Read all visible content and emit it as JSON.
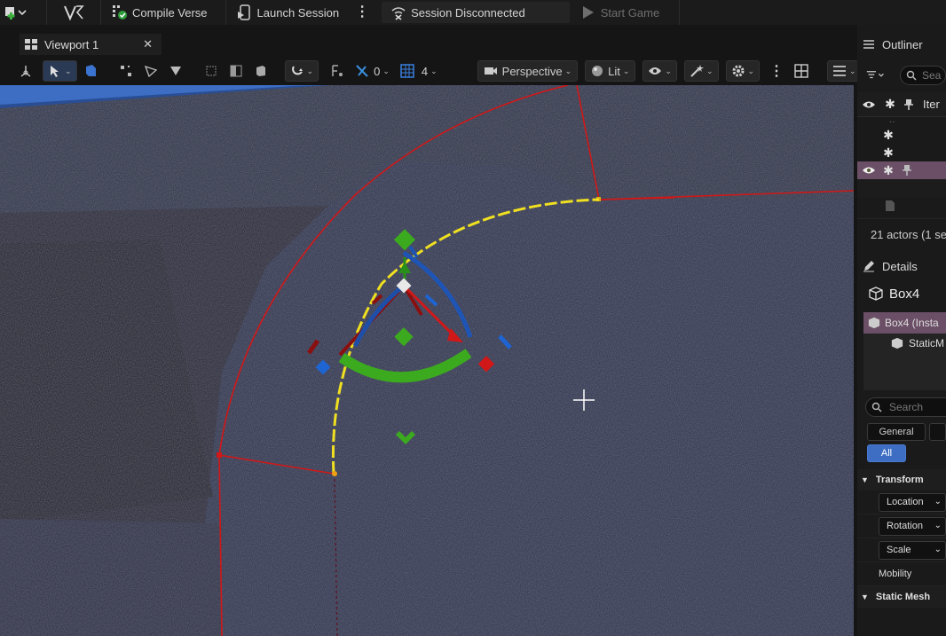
{
  "toolbar": {
    "compile_verse": "Compile Verse",
    "launch_session": "Launch Session",
    "session_status": "Session Disconnected",
    "start_game": "Start Game"
  },
  "viewport_tab": {
    "label": "Viewport 1",
    "close": "✕"
  },
  "viewport_toolbar": {
    "rotation_snap_value": "0",
    "grid_value": "4",
    "view_mode": "Perspective",
    "lighting_mode": "Lit"
  },
  "outliner": {
    "title": "Outliner",
    "search_placeholder": "Sea",
    "column_item_label": "Iter",
    "actor_count": "21 actors (1 se"
  },
  "details": {
    "title": "Details",
    "object_name": "Box4",
    "component_root": "Box4 (Insta",
    "component_child": "StaticM",
    "search_placeholder": "Search",
    "filter_general": "General",
    "filter_all": "All",
    "section_transform": "Transform",
    "prop_location": "Location",
    "prop_rotation": "Rotation",
    "prop_scale": "Scale",
    "prop_mobility": "Mobility",
    "section_static_mesh": "Static Mesh"
  },
  "colors": {
    "accent_blue": "#3d6ec4",
    "gizmo_red": "#d01818",
    "gizmo_green": "#3caa1e",
    "gizmo_blue": "#1e64d2",
    "selection_yellow": "#f0e020",
    "selected_row": "#6b4f66",
    "floor_navy": "#2b3152"
  },
  "icons": [
    "add-content-icon",
    "verse-icon",
    "compile-icon",
    "launch-icon",
    "more-icon",
    "session-icon",
    "play-icon",
    "viewport-grid-icon",
    "eye-icon",
    "star-icon",
    "pin-icon",
    "filter-icon",
    "search-icon",
    "pencil-icon",
    "cube-icon"
  ]
}
